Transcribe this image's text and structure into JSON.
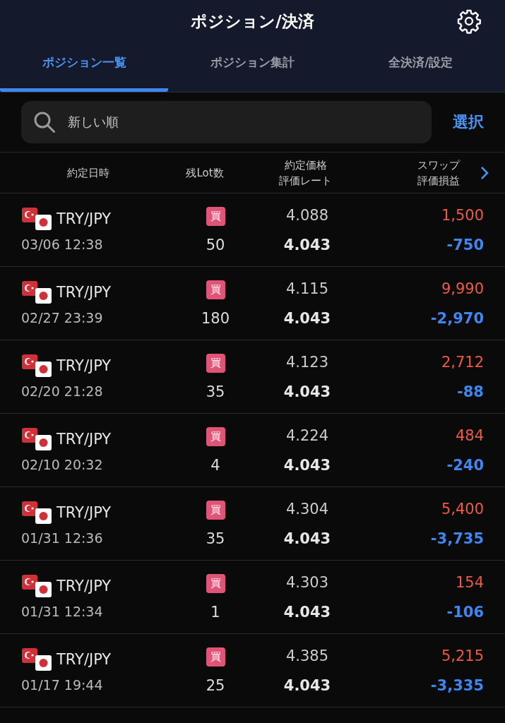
{
  "window": {
    "title": "ポジション/決済"
  },
  "tabs": [
    {
      "label": "ポジション一覧",
      "selected": true
    },
    {
      "label": "ポジション集計",
      "selected": false
    },
    {
      "label": "全決済/設定",
      "selected": false
    }
  ],
  "sort_field": {
    "value": "新しい順"
  },
  "select_button": "選択",
  "columns": [
    {
      "label": "約定日時"
    },
    {
      "label": "残Lot数"
    },
    {
      "label": "約定価格",
      "sub": "評価レート"
    },
    {
      "label": "スワップ",
      "sub": "評価損益"
    }
  ],
  "rows": [
    {
      "pair": "TRY/JPY",
      "date": "03/06 12:38",
      "side": "買",
      "lots": "50",
      "price": "4.088",
      "rate": "4.043",
      "swap": "1,500",
      "pnl": "-750"
    },
    {
      "pair": "TRY/JPY",
      "date": "02/27 23:39",
      "side": "買",
      "lots": "180",
      "price": "4.115",
      "rate": "4.043",
      "swap": "9,990",
      "pnl": "-2,970"
    },
    {
      "pair": "TRY/JPY",
      "date": "02/20 21:28",
      "side": "買",
      "lots": "35",
      "price": "4.123",
      "rate": "4.043",
      "swap": "2,712",
      "pnl": "-88"
    },
    {
      "pair": "TRY/JPY",
      "date": "02/10 20:32",
      "side": "買",
      "lots": "4",
      "price": "4.224",
      "rate": "4.043",
      "swap": "484",
      "pnl": "-240"
    },
    {
      "pair": "TRY/JPY",
      "date": "01/31 12:36",
      "side": "買",
      "lots": "35",
      "price": "4.304",
      "rate": "4.043",
      "swap": "5,400",
      "pnl": "-3,735"
    },
    {
      "pair": "TRY/JPY",
      "date": "01/31 12:34",
      "side": "買",
      "lots": "1",
      "price": "4.303",
      "rate": "4.043",
      "swap": "154",
      "pnl": "-106"
    },
    {
      "pair": "TRY/JPY",
      "date": "01/17 19:44",
      "side": "買",
      "lots": "25",
      "price": "4.385",
      "rate": "4.043",
      "swap": "5,215",
      "pnl": "-3,335"
    }
  ]
}
